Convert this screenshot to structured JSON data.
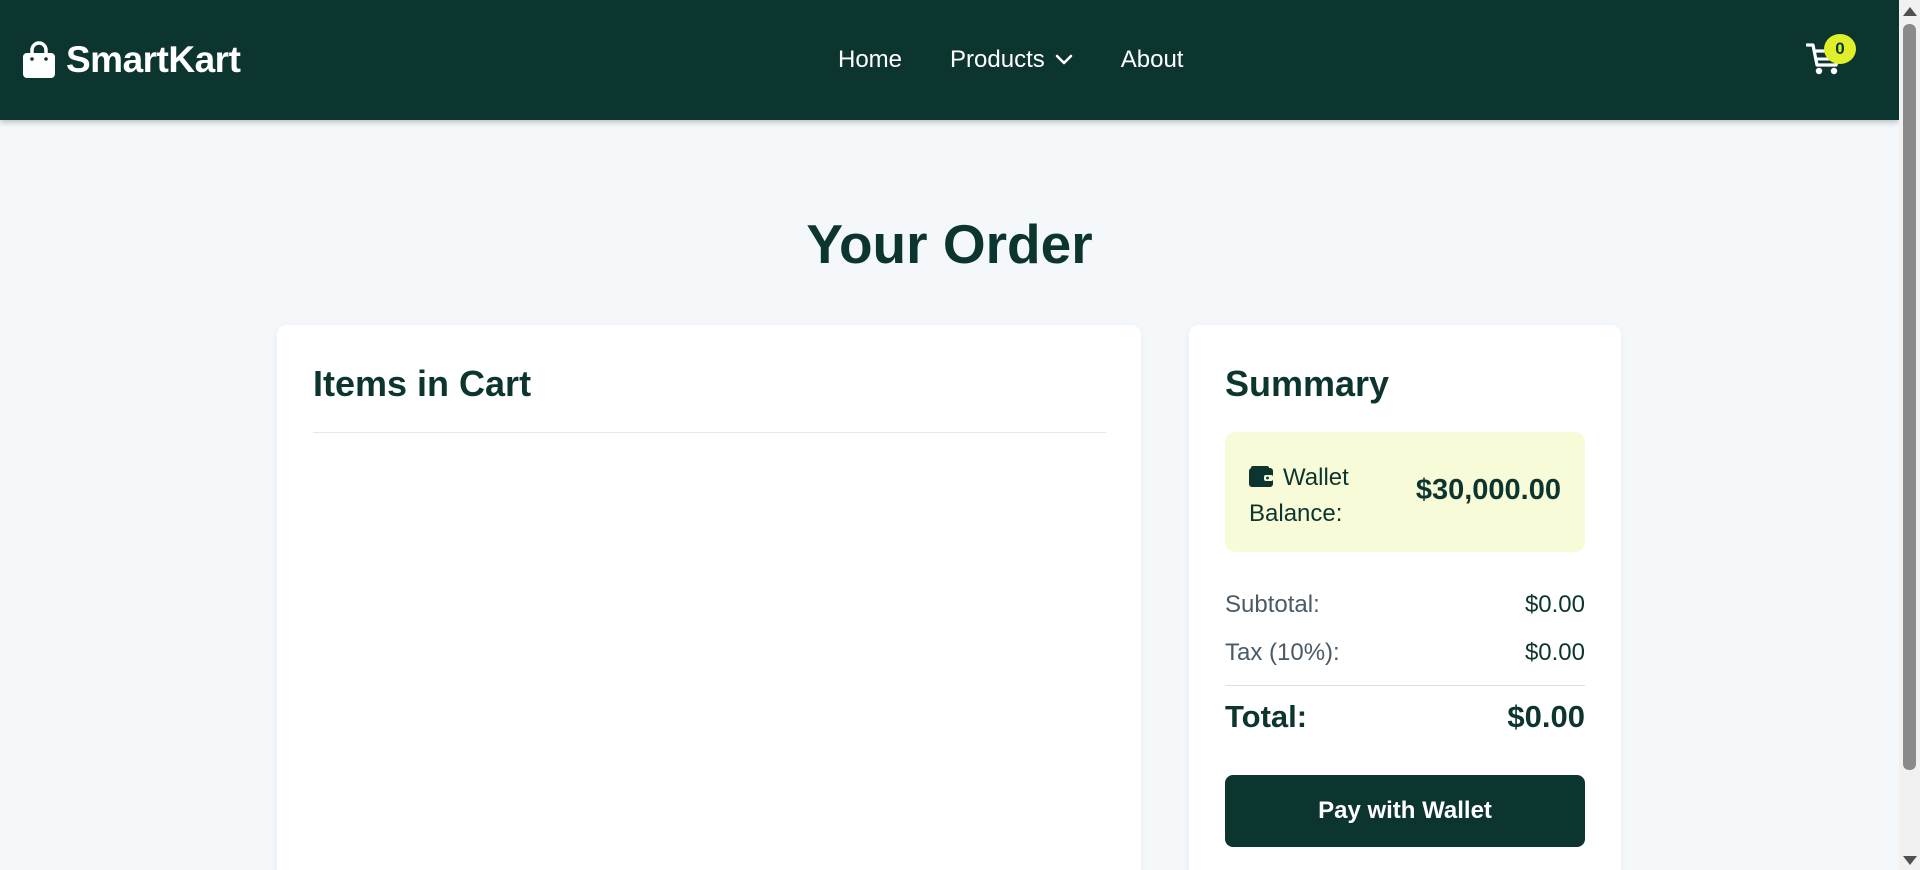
{
  "header": {
    "brand": "SmartKart",
    "nav": [
      {
        "label": "Home"
      },
      {
        "label": "Products",
        "icon": "chevron-down-icon"
      },
      {
        "label": "About"
      }
    ],
    "cart_count": "0"
  },
  "page": {
    "title": "Your Order"
  },
  "cart": {
    "title": "Items in Cart",
    "items": []
  },
  "summary": {
    "title": "Summary",
    "wallet_label": "Wallet Balance:",
    "wallet_balance": "$30,000.00",
    "subtotal_label": "Subtotal:",
    "subtotal_value": "$0.00",
    "tax_label": "Tax (10%):",
    "tax_value": "$0.00",
    "total_label": "Total:",
    "total_value": "$0.00",
    "pay_button": "Pay with Wallet"
  },
  "colors": {
    "primary": "#0d3530",
    "badge": "#dfef2a",
    "wallet_bg": "#f7fbd8",
    "page_bg": "#f4f8fb"
  }
}
